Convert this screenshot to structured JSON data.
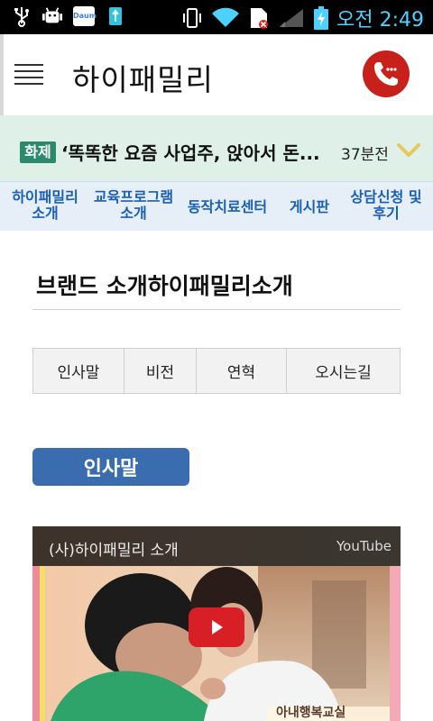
{
  "status_bar": {
    "time": "오전 2:49",
    "icons": [
      "usb-icon",
      "android-debug-icon",
      "daum-app-icon",
      "usb-storage-icon",
      "vibrate-icon",
      "wifi-icon",
      "sim-error-icon",
      "signal-icon",
      "battery-charging-icon"
    ],
    "daum_label": "Daum"
  },
  "app_bar": {
    "title": "하이패밀리",
    "accent_color": "#c8201b"
  },
  "ticker": {
    "topic": "화제",
    "headline": "‘똑똑한 요즘 사업주, 앉아서 돈...",
    "age": "37분전"
  },
  "nav": {
    "items": [
      {
        "line1": "하이패밀리",
        "line2": "소개"
      },
      {
        "line1": "교육프로그램",
        "line2": "소개"
      },
      {
        "line1": "동작치료센터",
        "line2": ""
      },
      {
        "line1": "게시판",
        "line2": ""
      },
      {
        "line1": "상담신청 및",
        "line2": "후기"
      }
    ]
  },
  "page": {
    "brand_title": "브랜드 소개하이패밀리소개",
    "tabs": [
      "인사말",
      "비전",
      "연혁",
      "오시는길"
    ],
    "section_button": "인사말"
  },
  "video": {
    "title": "(사)하이패밀리 소개",
    "provider": "YouTube",
    "caption": "아내행복교실"
  }
}
